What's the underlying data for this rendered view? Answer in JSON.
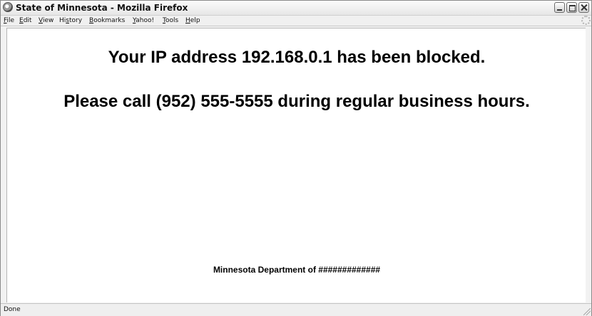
{
  "window": {
    "title": "State of Minnesota - Mozilla Firefox"
  },
  "menubar": {
    "items": [
      {
        "label": "File",
        "accel": "F",
        "rest": "ile"
      },
      {
        "label": "Edit",
        "accel": "E",
        "rest": "dit"
      },
      {
        "label": "View",
        "accel": "V",
        "rest": "iew"
      },
      {
        "label": "History",
        "pre": "Hi",
        "accel": "s",
        "rest": "tory"
      },
      {
        "label": "Bookmarks",
        "accel": "B",
        "rest": "ookmarks"
      },
      {
        "label": "Yahoo!",
        "accel": "Y",
        "rest": "ahoo!"
      },
      {
        "label": "Tools",
        "accel": "T",
        "rest": "ools"
      },
      {
        "label": "Help",
        "accel": "H",
        "rest": "elp"
      }
    ]
  },
  "page": {
    "headline_1": "Your IP address 192.168.0.1 has been blocked.",
    "headline_2": "Please call (952) 555-5555 during regular business hours.",
    "footer": "Minnesota Department of #############"
  },
  "statusbar": {
    "text": "Done"
  },
  "icons": {
    "app": "firefox-icon",
    "minimize": "minimize-icon",
    "maximize": "maximize-icon",
    "close": "close-icon",
    "throbber": "throbber-icon",
    "resize": "resize-grip-icon"
  },
  "colors": {
    "window_bg": "#f2f2f2",
    "content_bg": "#ffffff",
    "text": "#000000"
  }
}
